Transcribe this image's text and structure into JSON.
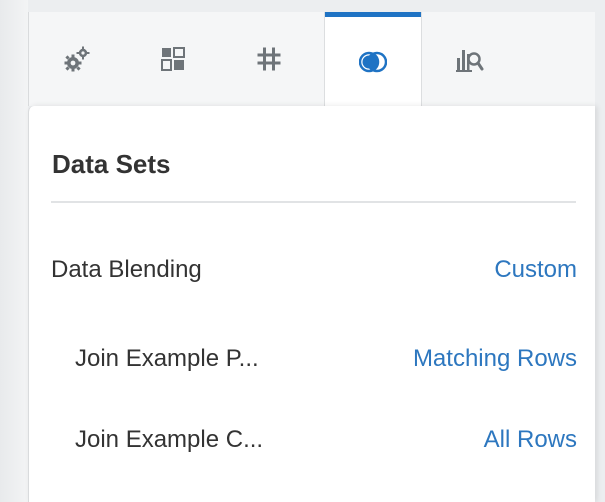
{
  "tabs": [
    {
      "icon": "gears-icon",
      "active": false
    },
    {
      "icon": "layout-grid-icon",
      "active": false
    },
    {
      "icon": "hash-icon",
      "active": false
    },
    {
      "icon": "blend-circles-icon",
      "active": true
    },
    {
      "icon": "chart-search-icon",
      "active": false
    }
  ],
  "panel": {
    "title": "Data Sets",
    "data_blending": {
      "label": "Data Blending",
      "value": "Custom"
    },
    "joins": [
      {
        "label": "Join Example P...",
        "value": "Matching Rows"
      },
      {
        "label": "Join Example C...",
        "value": "All Rows"
      }
    ]
  },
  "colors": {
    "accent": "#1f73c4",
    "link": "#2d77bf",
    "icon_gray": "#6e7479",
    "text": "#333333"
  }
}
